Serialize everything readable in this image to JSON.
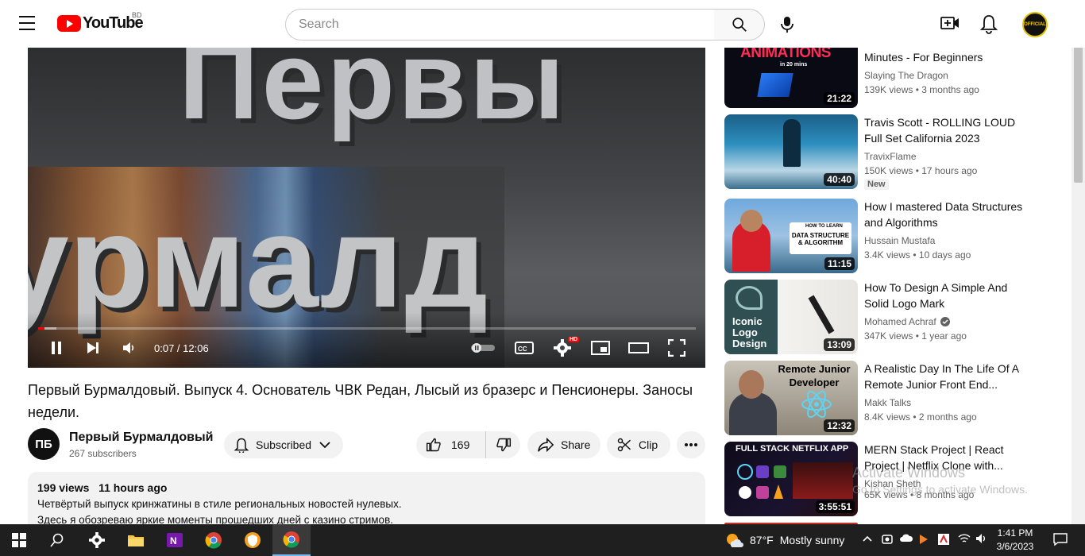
{
  "header": {
    "logo_text": "YouTube",
    "country_code": "BD",
    "search_placeholder": "Search",
    "avatar_text": "OFFICIAL"
  },
  "player": {
    "overlay_top_text": "Первы",
    "overlay_bottom_text": "урмалд",
    "time_display": "0:07 / 12:06",
    "progress_fraction": 0.0096,
    "hd_badge": "HD"
  },
  "video": {
    "title": "Первый Бурмалдовый. Выпуск 4. Основатель ЧВК Редан, Лысый из бразерс и Пенсионеры. Заносы недели.",
    "channel_avatar_text": "ПБ",
    "channel_name": "Первый Бурмалдовый",
    "subscribers": "267 subscribers",
    "subscribe_label": "Subscribed",
    "like_count": "169",
    "share_label": "Share",
    "clip_label": "Clip",
    "description": {
      "views": "199 views",
      "time_ago": "11 hours ago",
      "line1": "Четвёртый выпуск кринжатины в стиле региональных новостей нулевых.",
      "line2": "Здесь я обозреваю яркие моменты прошедших дней с казино стримов."
    }
  },
  "sidebar": {
    "items": [
      {
        "title": "Minutes - For Beginners",
        "channel": "Slaying The Dragon",
        "views": "139K views",
        "age": "3 months ago",
        "duration": "21:22",
        "thumb_text": "ANIMATIONS",
        "thumb_sub": "in 20 mins"
      },
      {
        "title": "Travis Scott - ROLLING LOUD Full Set California 2023",
        "channel": "TravixFlame",
        "views": "150K views",
        "age": "17 hours ago",
        "duration": "40:40",
        "badge": "New"
      },
      {
        "title": "How I mastered Data Structures and Algorithms",
        "channel": "Hussain Mustafa",
        "views": "3.4K views",
        "age": "10 days ago",
        "duration": "11:15",
        "thumb_text": "HOW TO LEARN",
        "thumb_sub": "DATA STRUCTURE & ALGORITHM"
      },
      {
        "title": "How To Design A Simple And Solid Logo Mark",
        "channel": "Mohamed Achraf",
        "views": "347K views",
        "age": "1 year ago",
        "duration": "13:09",
        "thumb_text": "Iconic Logo Design"
      },
      {
        "title": "A Realistic Day In The Life Of A Remote Junior Front End...",
        "channel": "Makk Talks",
        "views": "8.4K views",
        "age": "2 months ago",
        "duration": "12:32",
        "thumb_text": "Remote Junior Developer"
      },
      {
        "title": "MERN Stack Project | React Project | Netflix Clone with...",
        "channel": "Kishan Sheth",
        "views": "65K views",
        "age": "8 months ago",
        "duration": "3:55:51",
        "thumb_text": "FULL STACK NETFLIX APP"
      }
    ]
  },
  "watermark": {
    "line1": "Activate Windows",
    "line2": "Go to Settings to activate Windows."
  },
  "taskbar": {
    "weather_temp": "87°F",
    "weather_text": "Mostly sunny",
    "time": "1:41 PM",
    "date": "3/6/2023"
  },
  "colors": {
    "youtube_red": "#ff0000",
    "taskbar_bg": "#1f1f1f",
    "pill_bg": "#f2f2f2"
  }
}
